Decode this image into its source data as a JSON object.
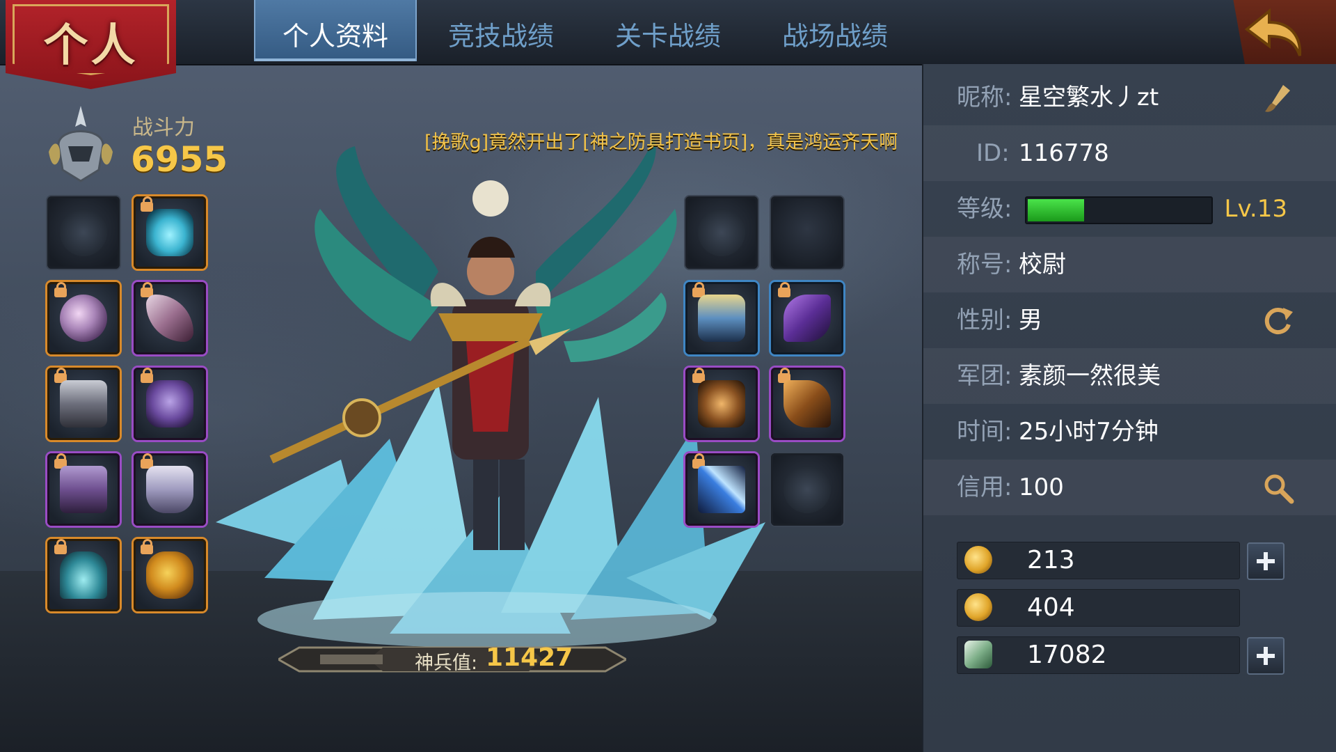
{
  "banner": {
    "title": "个人"
  },
  "tabs": [
    {
      "label": "个人资料",
      "active": true
    },
    {
      "label": "竞技战绩",
      "active": false
    },
    {
      "label": "关卡战绩",
      "active": false
    },
    {
      "label": "战场战绩",
      "active": false
    }
  ],
  "power": {
    "label": "战斗力",
    "value": "6955"
  },
  "announcement": "[挽歌g]竟然开出了[神之防具打造书页]，真是鸿运齐天啊",
  "godweapon": {
    "label": "神兵值:",
    "value": "11427"
  },
  "profile": {
    "nickname": {
      "label": "昵称:",
      "value": "星空繁水丿zt"
    },
    "id": {
      "label": "ID:",
      "value": "116778"
    },
    "level": {
      "label": "等级:",
      "value": "Lv.13",
      "progress": 0.31
    },
    "title": {
      "label": "称号:",
      "value": "校尉"
    },
    "gender": {
      "label": "性别:",
      "value": "男"
    },
    "legion": {
      "label": "军团:",
      "value": "素颜一然很美"
    },
    "time": {
      "label": "时间:",
      "value": "25小时7分钟"
    },
    "credit": {
      "label": "信用:",
      "value": "100"
    }
  },
  "currency": [
    {
      "icon": "gold-coin-icon",
      "value": "213",
      "has_plus": true
    },
    {
      "icon": "locked-gold-coin-icon",
      "value": "404",
      "has_plus": false
    },
    {
      "icon": "jade-icon",
      "value": "17082",
      "has_plus": true
    }
  ],
  "colors": {
    "accent_gold": "#f6c748",
    "tab_active": "#4f79a4",
    "level_fill": "#2bc42b"
  },
  "icons": {
    "edit": "brush-icon",
    "gender": "refresh-icon",
    "credit": "magnifier-icon",
    "back": "return-arrow-icon",
    "power": "helmet-emblem-icon"
  }
}
